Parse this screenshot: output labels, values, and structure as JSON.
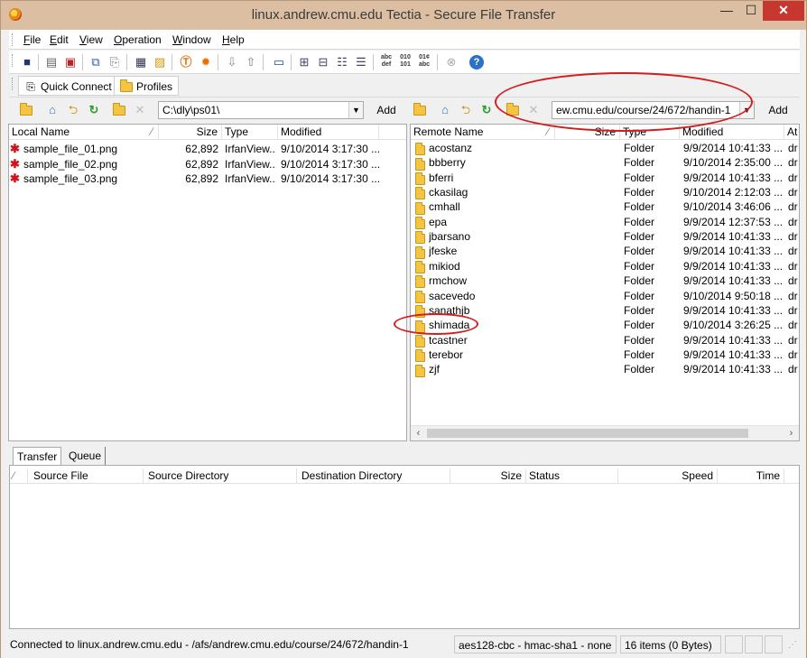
{
  "window": {
    "title": "linux.andrew.cmu.edu Tectia - Secure File Transfer",
    "minimize": "—",
    "maximize": "☐",
    "close": "✕"
  },
  "menu": [
    "File",
    "Edit",
    "View",
    "Operation",
    "Window",
    "Help"
  ],
  "toolbar": {
    "icons": [
      "save-icon",
      "print-icon",
      "print-preview-icon",
      "copy-icon",
      "paste-icon",
      "new-terminal-icon",
      "new-transfer-icon",
      "tectia-icon",
      "settings-icon",
      "download-icon",
      "upload-icon",
      "view-icon",
      "large-icons-icon",
      "small-icons-icon",
      "list-icon",
      "ascii-mode-icon",
      "binary-mode-icon",
      "auto-mode-icon",
      "stop-icon",
      "help-icon"
    ],
    "ascii_label": "abc def",
    "binary_label": "010 101",
    "auto_label": "01¢ abc"
  },
  "quickbar": {
    "quick_connect": "Quick Connect",
    "profiles": "Profiles"
  },
  "local": {
    "path": "C:\\dly\\ps01\\",
    "add": "Add",
    "columns": {
      "name": "Local Name",
      "size": "Size",
      "type": "Type",
      "modified": "Modified"
    },
    "files": [
      {
        "name": "sample_file_01.png",
        "size": "62,892",
        "type": "IrfanView...",
        "modified": "9/10/2014 3:17:30 ..."
      },
      {
        "name": "sample_file_02.png",
        "size": "62,892",
        "type": "IrfanView...",
        "modified": "9/10/2014 3:17:30 ..."
      },
      {
        "name": "sample_file_03.png",
        "size": "62,892",
        "type": "IrfanView...",
        "modified": "9/10/2014 3:17:30 ..."
      }
    ]
  },
  "remote": {
    "path": "ew.cmu.edu/course/24/672/handin-1",
    "add": "Add",
    "columns": {
      "name": "Remote Name",
      "size": "Size",
      "type": "Type",
      "modified": "Modified",
      "attr": "At"
    },
    "files": [
      {
        "name": "acostanz",
        "type": "Folder",
        "modified": "9/9/2014 10:41:33 ...",
        "attr": "dr"
      },
      {
        "name": "bbberry",
        "type": "Folder",
        "modified": "9/10/2014 2:35:00 ...",
        "attr": "dr"
      },
      {
        "name": "bferri",
        "type": "Folder",
        "modified": "9/9/2014 10:41:33 ...",
        "attr": "dr"
      },
      {
        "name": "ckasilag",
        "type": "Folder",
        "modified": "9/10/2014 2:12:03 ...",
        "attr": "dr"
      },
      {
        "name": "cmhall",
        "type": "Folder",
        "modified": "9/10/2014 3:46:06 ...",
        "attr": "dr"
      },
      {
        "name": "epa",
        "type": "Folder",
        "modified": "9/9/2014 12:37:53 ...",
        "attr": "dr"
      },
      {
        "name": "jbarsano",
        "type": "Folder",
        "modified": "9/9/2014 10:41:33 ...",
        "attr": "dr"
      },
      {
        "name": "jfeske",
        "type": "Folder",
        "modified": "9/9/2014 10:41:33 ...",
        "attr": "dr"
      },
      {
        "name": "mikiod",
        "type": "Folder",
        "modified": "9/9/2014 10:41:33 ...",
        "attr": "dr"
      },
      {
        "name": "rmchow",
        "type": "Folder",
        "modified": "9/9/2014 10:41:33 ...",
        "attr": "dr"
      },
      {
        "name": "sacevedo",
        "type": "Folder",
        "modified": "9/10/2014 9:50:18 ...",
        "attr": "dr"
      },
      {
        "name": "sanathjb",
        "type": "Folder",
        "modified": "9/9/2014 10:41:33 ...",
        "attr": "dr"
      },
      {
        "name": "shimada",
        "type": "Folder",
        "modified": "9/10/2014 3:26:25 ...",
        "attr": "dr"
      },
      {
        "name": "tcastner",
        "type": "Folder",
        "modified": "9/9/2014 10:41:33 ...",
        "attr": "dr"
      },
      {
        "name": "terebor",
        "type": "Folder",
        "modified": "9/9/2014 10:41:33 ...",
        "attr": "dr"
      },
      {
        "name": "zjf",
        "type": "Folder",
        "modified": "9/9/2014 10:41:33 ...",
        "attr": "dr"
      }
    ]
  },
  "transfer": {
    "tabs": [
      "Transfer",
      "Queue"
    ],
    "columns": {
      "source_file": "Source File",
      "source_dir": "Source Directory",
      "dest_dir": "Destination Directory",
      "size": "Size",
      "status": "Status",
      "speed": "Speed",
      "time": "Time"
    }
  },
  "status": {
    "connection": "Connected to linux.andrew.cmu.edu - /afs/andrew.cmu.edu/course/24/672/handin-1",
    "cipher": "aes128-cbc - hmac-sha1 - none",
    "items": "16 items (0 Bytes)"
  },
  "colors": {
    "annotation": "#d41d1d",
    "titlebar": "#dcbfa2",
    "close_button": "#c7372f",
    "folder": "#f4c542"
  }
}
